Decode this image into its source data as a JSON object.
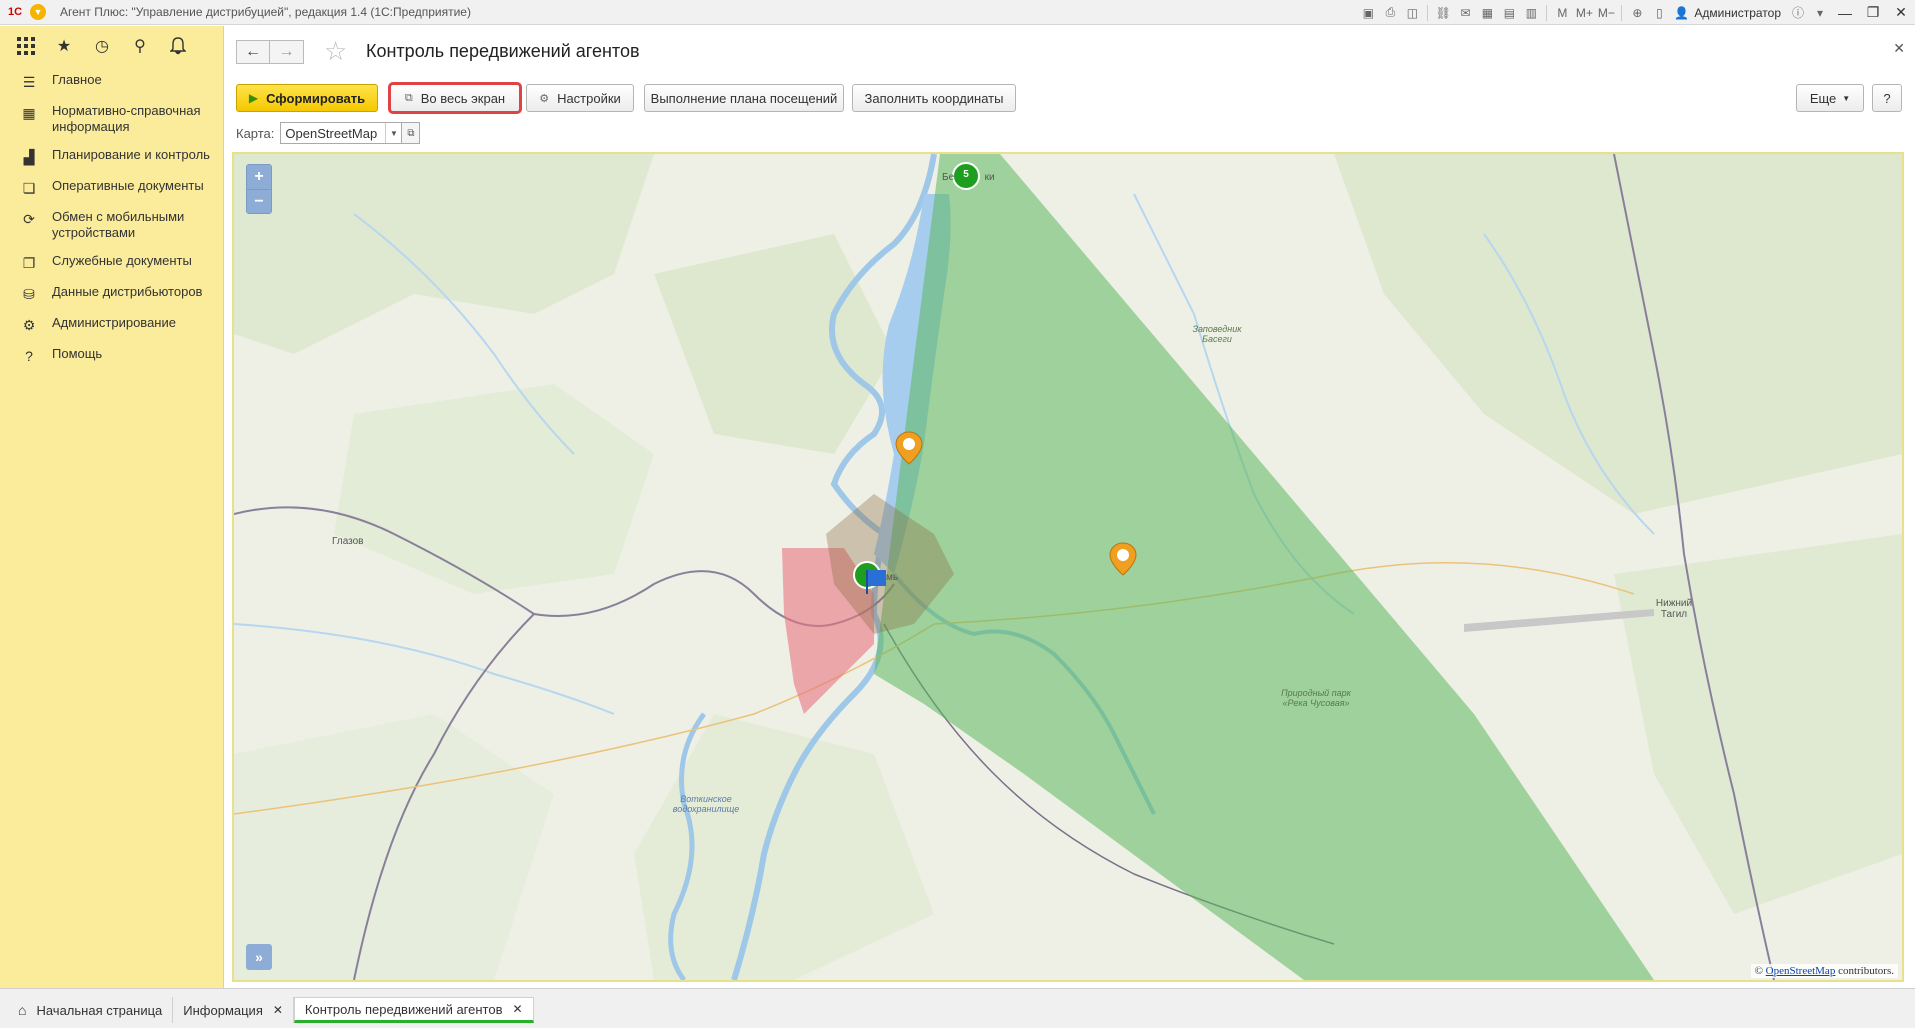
{
  "window": {
    "title": "Агент Плюс: \"Управление дистрибуцией\", редакция 1.4  (1С:Предприятие)",
    "logo": "1С",
    "user": "Администратор"
  },
  "sidebar": {
    "top_icons": [
      "apps-grid-icon",
      "favorites-star-icon",
      "history-icon",
      "search-icon",
      "notifications-bell-icon"
    ],
    "items": [
      {
        "label": "Главное",
        "icon": "menu-lines-icon"
      },
      {
        "label": "Нормативно-справочная информация",
        "icon": "reference-icon"
      },
      {
        "label": "Планирование и контроль",
        "icon": "bar-chart-icon"
      },
      {
        "label": "Оперативные документы",
        "icon": "documents-icon"
      },
      {
        "label": "Обмен с мобильными устройствами",
        "icon": "sync-icon"
      },
      {
        "label": "Служебные документы",
        "icon": "service-docs-icon"
      },
      {
        "label": "Данные дистрибьюторов",
        "icon": "distributor-data-icon"
      },
      {
        "label": "Администрирование",
        "icon": "gear-icon"
      },
      {
        "label": "Помощь",
        "icon": "help-icon"
      }
    ]
  },
  "form": {
    "title": "Контроль передвижений агентов",
    "buttons": {
      "generate": "Сформировать",
      "fullscreen": "Во весь экран",
      "settings": "Настройки",
      "plan": "Выполнение плана посещений",
      "fill_coords": "Заполнить координаты",
      "more": "Еще",
      "help": "?"
    },
    "map_label": "Карта:",
    "map_value": "OpenStreetMap"
  },
  "map": {
    "attribution_prefix": "©",
    "attribution_link": "OpenStreetMap",
    "attribution_suffix": "contributors.",
    "cluster_count": "5",
    "cities": {
      "glazov": "Глазов",
      "perm": "мь",
      "berezniki": "Бе           ки",
      "nizhny_tagil": "Нижний Тагил",
      "reserve": "Заповедник Басеги",
      "park": "Природный парк «Река Чусовая»",
      "reservoir": "Воткинское водохранилище"
    },
    "colors": {
      "green_zone": "#5cb85c",
      "red_zone": "#e8747f",
      "marker_orange": "#f0a020",
      "marker_green": "#1e9e1e"
    }
  },
  "taskbar": {
    "tabs": [
      {
        "label": "Начальная страница",
        "icon": "home-icon"
      },
      {
        "label": "Информация"
      },
      {
        "label": "Контроль передвижений агентов"
      }
    ]
  }
}
